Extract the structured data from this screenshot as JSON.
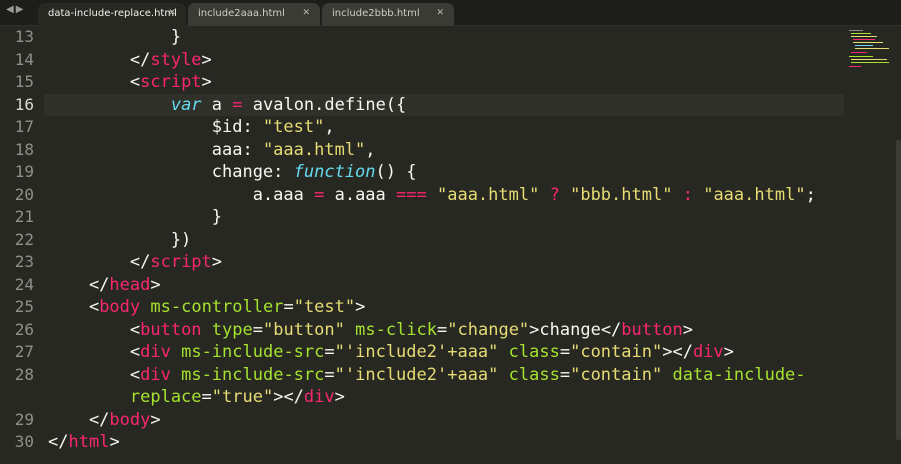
{
  "tabs": [
    {
      "label": "data-include-replace.html",
      "active": true
    },
    {
      "label": "include2aaa.html",
      "active": false
    },
    {
      "label": "include2bbb.html",
      "active": false
    }
  ],
  "nav": {
    "back": "◀",
    "forward": "▶"
  },
  "close_glyph": "✕",
  "current_line": "16",
  "lines": [
    {
      "num": "13",
      "code": [
        {
          "c": "p",
          "t": "            }"
        }
      ]
    },
    {
      "num": "14",
      "code": [
        {
          "c": "p",
          "t": "        </"
        },
        {
          "c": "t",
          "t": "style"
        },
        {
          "c": "p",
          "t": ">"
        }
      ]
    },
    {
      "num": "15",
      "code": [
        {
          "c": "p",
          "t": "        <"
        },
        {
          "c": "t",
          "t": "script"
        },
        {
          "c": "p",
          "t": ">"
        }
      ]
    },
    {
      "num": "16",
      "code": [
        {
          "c": "p",
          "t": "            "
        },
        {
          "c": "k",
          "t": "var"
        },
        {
          "c": "p",
          "t": " a "
        },
        {
          "c": "o",
          "t": "="
        },
        {
          "c": "p",
          "t": " avalon.define({"
        }
      ]
    },
    {
      "num": "17",
      "code": [
        {
          "c": "p",
          "t": "                $id: "
        },
        {
          "c": "s",
          "t": "\"test\""
        },
        {
          "c": "p",
          "t": ","
        }
      ]
    },
    {
      "num": "18",
      "code": [
        {
          "c": "p",
          "t": "                aaa: "
        },
        {
          "c": "s",
          "t": "\"aaa.html\""
        },
        {
          "c": "p",
          "t": ","
        }
      ]
    },
    {
      "num": "19",
      "code": [
        {
          "c": "p",
          "t": "                change: "
        },
        {
          "c": "k",
          "t": "function"
        },
        {
          "c": "p",
          "t": "() {"
        }
      ]
    },
    {
      "num": "20",
      "code": [
        {
          "c": "p",
          "t": "                    a.aaa "
        },
        {
          "c": "o",
          "t": "="
        },
        {
          "c": "p",
          "t": " a.aaa "
        },
        {
          "c": "o",
          "t": "==="
        },
        {
          "c": "p",
          "t": " "
        },
        {
          "c": "s",
          "t": "\"aaa.html\""
        },
        {
          "c": "p",
          "t": " "
        },
        {
          "c": "o",
          "t": "?"
        },
        {
          "c": "p",
          "t": " "
        },
        {
          "c": "s",
          "t": "\"bbb.html\""
        },
        {
          "c": "p",
          "t": " "
        },
        {
          "c": "o",
          "t": ":"
        },
        {
          "c": "p",
          "t": " "
        },
        {
          "c": "s",
          "t": "\"aaa.html\""
        },
        {
          "c": "p",
          "t": ";"
        }
      ]
    },
    {
      "num": "21",
      "code": [
        {
          "c": "p",
          "t": "                }"
        }
      ]
    },
    {
      "num": "22",
      "code": [
        {
          "c": "p",
          "t": "            })"
        }
      ]
    },
    {
      "num": "23",
      "code": [
        {
          "c": "p",
          "t": "        </"
        },
        {
          "c": "t",
          "t": "script"
        },
        {
          "c": "p",
          "t": ">"
        }
      ]
    },
    {
      "num": "24",
      "code": [
        {
          "c": "p",
          "t": "    </"
        },
        {
          "c": "t",
          "t": "head"
        },
        {
          "c": "p",
          "t": ">"
        }
      ]
    },
    {
      "num": "25",
      "code": [
        {
          "c": "p",
          "t": "    <"
        },
        {
          "c": "t",
          "t": "body"
        },
        {
          "c": "p",
          "t": " "
        },
        {
          "c": "a",
          "t": "ms-controller"
        },
        {
          "c": "p",
          "t": "="
        },
        {
          "c": "s",
          "t": "\"test\""
        },
        {
          "c": "p",
          "t": ">"
        }
      ]
    },
    {
      "num": "26",
      "code": [
        {
          "c": "p",
          "t": "        <"
        },
        {
          "c": "t",
          "t": "button"
        },
        {
          "c": "p",
          "t": " "
        },
        {
          "c": "a",
          "t": "type"
        },
        {
          "c": "p",
          "t": "="
        },
        {
          "c": "s",
          "t": "\"button\""
        },
        {
          "c": "p",
          "t": " "
        },
        {
          "c": "a",
          "t": "ms-click"
        },
        {
          "c": "p",
          "t": "="
        },
        {
          "c": "s",
          "t": "\"change\""
        },
        {
          "c": "p",
          "t": ">change</"
        },
        {
          "c": "t",
          "t": "button"
        },
        {
          "c": "p",
          "t": ">"
        }
      ]
    },
    {
      "num": "27",
      "code": [
        {
          "c": "p",
          "t": "        <"
        },
        {
          "c": "t",
          "t": "div"
        },
        {
          "c": "p",
          "t": " "
        },
        {
          "c": "a",
          "t": "ms-include-src"
        },
        {
          "c": "p",
          "t": "="
        },
        {
          "c": "s",
          "t": "\"'include2'+aaa\""
        },
        {
          "c": "p",
          "t": " "
        },
        {
          "c": "a",
          "t": "class"
        },
        {
          "c": "p",
          "t": "="
        },
        {
          "c": "s",
          "t": "\"contain\""
        },
        {
          "c": "p",
          "t": "></"
        },
        {
          "c": "t",
          "t": "div"
        },
        {
          "c": "p",
          "t": ">"
        }
      ]
    },
    {
      "num": "28",
      "code": [
        {
          "c": "p",
          "t": "        <"
        },
        {
          "c": "t",
          "t": "div"
        },
        {
          "c": "p",
          "t": " "
        },
        {
          "c": "a",
          "t": "ms-include-src"
        },
        {
          "c": "p",
          "t": "="
        },
        {
          "c": "s",
          "t": "\"'include2'+aaa\""
        },
        {
          "c": "p",
          "t": " "
        },
        {
          "c": "a",
          "t": "class"
        },
        {
          "c": "p",
          "t": "="
        },
        {
          "c": "s",
          "t": "\"contain\""
        },
        {
          "c": "p",
          "t": " "
        },
        {
          "c": "a",
          "t": "data-include-"
        }
      ]
    },
    {
      "num": "",
      "code": [
        {
          "c": "a",
          "t": "        replace"
        },
        {
          "c": "p",
          "t": "="
        },
        {
          "c": "s",
          "t": "\"true\""
        },
        {
          "c": "p",
          "t": "></"
        },
        {
          "c": "t",
          "t": "div"
        },
        {
          "c": "p",
          "t": ">"
        }
      ]
    },
    {
      "num": "29",
      "code": [
        {
          "c": "p",
          "t": "    </"
        },
        {
          "c": "t",
          "t": "body"
        },
        {
          "c": "p",
          "t": ">"
        }
      ]
    },
    {
      "num": "30",
      "code": [
        {
          "c": "p",
          "t": "</"
        },
        {
          "c": "t",
          "t": "html"
        },
        {
          "c": "p",
          "t": ">"
        }
      ]
    }
  ],
  "colors": {
    "background": "#272822",
    "tag": "#f92672",
    "attr": "#a6e22e",
    "string": "#e6db74",
    "keyword": "#66d9ef",
    "text": "#f8f8f2"
  }
}
